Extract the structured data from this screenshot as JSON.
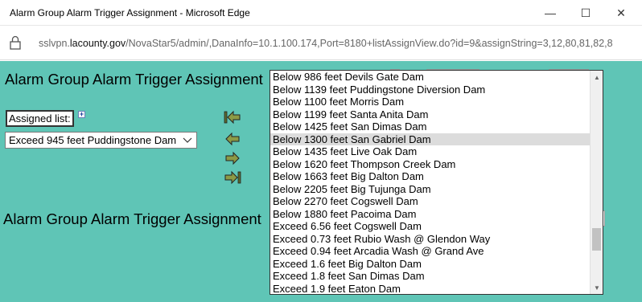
{
  "window": {
    "title": "Alarm Group Alarm Trigger Assignment - Microsoft Edge",
    "minimize_glyph": "—",
    "maximize_glyph": "☐",
    "close_glyph": "✕"
  },
  "address": {
    "url_prefix": "sslvpn.",
    "url_host": "lacounty.gov",
    "url_rest": "/NovaStar5/admin/,DanaInfo=10.1.100.174,Port=8180+listAssignView.do?id=9&assignString=3,12,80,81,82,8"
  },
  "page": {
    "heading_top": "Alarm Group Alarm Trigger Assignment",
    "heading_bottom": "Alarm Group Alarm Trigger Assignment",
    "assigned_label": "Assigned list:",
    "expand_glyph": "+",
    "assigned_select_value": "Exceed 945 feet Puddingstone Dam"
  },
  "arrows": {
    "move_first": "move-all-left",
    "move_left": "move-left",
    "move_right": "move-right",
    "move_last": "move-all-right"
  },
  "listbox": {
    "items": [
      "Below 986 feet Devils Gate Dam",
      "Below 1139 feet Puddingstone Diversion Dam",
      "Below 1100 feet Morris Dam",
      "Below 1199 feet Santa Anita Dam",
      "Below 1425 feet San Dimas Dam",
      "Below 1300 feet San Gabriel Dam",
      "Below 1435 feet Live Oak Dam",
      "Below 1620 feet Thompson Creek Dam",
      "Below 1663 feet Big Dalton Dam",
      "Below 2205 feet Big Tujunga Dam",
      "Below 2270 feet Cogswell Dam",
      "Below 1880 feet Pacoima Dam",
      "Exceed 6.56 feet Cogswell Dam",
      "Exceed 0.73 feet Rubio Wash @ Glendon Way",
      "Exceed 0.94 feet Arcadia Wash @ Grand Ave",
      "Exceed 1.6 feet Big Dalton Dam",
      "Exceed 1.8 feet San Dimas Dam",
      "Exceed 1.9 feet Eaton Dam"
    ],
    "selected_index": 5,
    "scroll_up_glyph": "▲",
    "scroll_down_glyph": "▼"
  }
}
